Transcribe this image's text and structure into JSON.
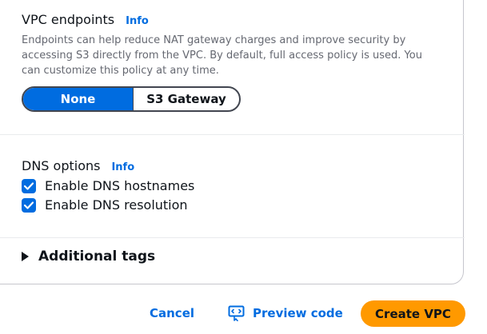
{
  "vpc_endpoints": {
    "title": "VPC endpoints",
    "info_label": "Info",
    "description": "Endpoints can help reduce NAT gateway charges and improve security by accessing S3 directly from the VPC. By default, full access policy is used. You can customize this policy at any time.",
    "options": [
      "None",
      "S3 Gateway"
    ],
    "selected": "None"
  },
  "dns_options": {
    "title": "DNS options",
    "info_label": "Info",
    "checkboxes": [
      {
        "label": "Enable DNS hostnames",
        "checked": true
      },
      {
        "label": "Enable DNS resolution",
        "checked": true
      }
    ]
  },
  "additional_tags": {
    "label": "Additional tags",
    "expanded": false
  },
  "footer": {
    "cancel_label": "Cancel",
    "preview_label": "Preview code",
    "create_label": "Create VPC"
  },
  "colors": {
    "link": "#006ce0",
    "primary_button": "#ff9900",
    "selected_segment": "#006ce0"
  }
}
